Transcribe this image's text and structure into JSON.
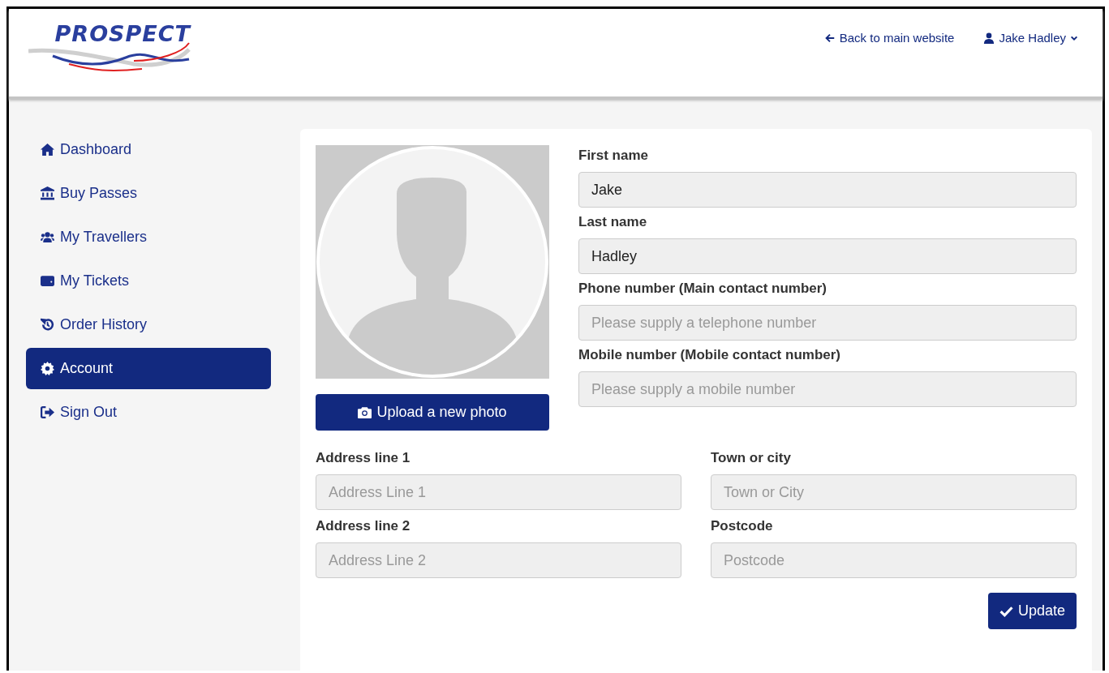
{
  "header": {
    "logo": "PROSPECT",
    "back_link": "Back to main website",
    "user_menu": "Jake Hadley"
  },
  "sidebar": {
    "items": [
      {
        "label": "Dashboard",
        "selected": false
      },
      {
        "label": "Buy Passes",
        "selected": false
      },
      {
        "label": "My Travellers",
        "selected": false
      },
      {
        "label": "My Tickets",
        "selected": false
      },
      {
        "label": "Order History",
        "selected": false
      },
      {
        "label": "Account",
        "selected": true
      },
      {
        "label": "Sign Out",
        "selected": false
      }
    ]
  },
  "profile": {
    "photo_button": "Upload a new photo",
    "fields": [
      {
        "label": "First name",
        "value": "Jake"
      },
      {
        "label": "Last name",
        "value": "Hadley"
      },
      {
        "label": "Phone number (Main contact number)",
        "placeholder": "Please supply a telephone number"
      },
      {
        "label": "Mobile number (Mobile contact number)",
        "placeholder": "Please supply a mobile number"
      }
    ],
    "address_fields": [
      {
        "label": "Address line 1",
        "placeholder": "Address Line 1"
      },
      {
        "label": "Town or city",
        "placeholder": "Town or City"
      },
      {
        "label": "Address line 2",
        "placeholder": "Address Line 2"
      },
      {
        "label": "Postcode",
        "placeholder": "Postcode"
      }
    ],
    "submit_button": "Update"
  }
}
